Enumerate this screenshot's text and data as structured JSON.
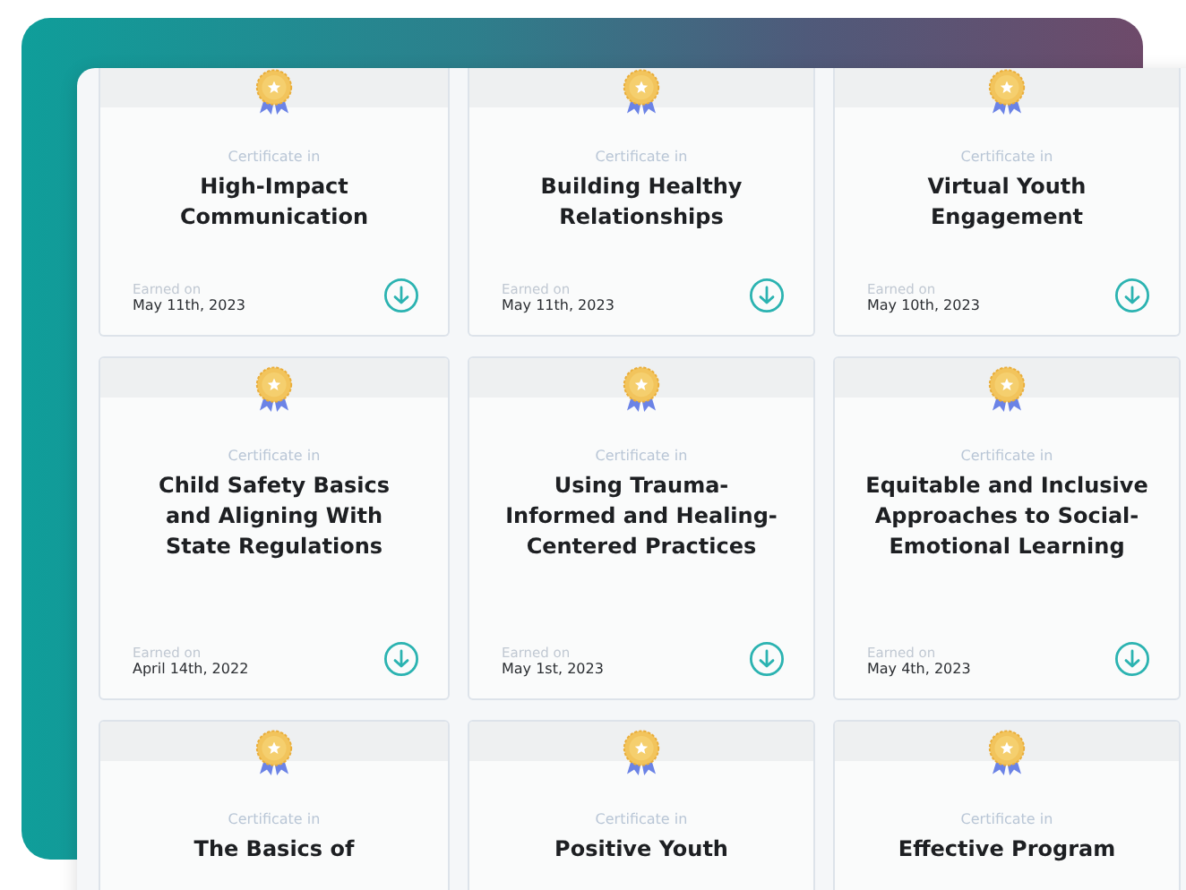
{
  "cards": [
    {
      "label": "Certificate in",
      "title": "High-Impact Communication",
      "earned_label": "Earned on",
      "date": "May 11th, 2023"
    },
    {
      "label": "Certificate in",
      "title": "Building Healthy Relationships",
      "earned_label": "Earned on",
      "date": "May 11th, 2023"
    },
    {
      "label": "Certificate in",
      "title": "Virtual Youth Engagement",
      "earned_label": "Earned on",
      "date": "May 10th, 2023"
    },
    {
      "label": "Certificate in",
      "title": "Child Safety Basics and Aligning With State Regulations",
      "earned_label": "Earned on",
      "date": "April 14th, 2022"
    },
    {
      "label": "Certificate in",
      "title": "Using Trauma-Informed and Healing-Centered Practices",
      "earned_label": "Earned on",
      "date": "May 1st, 2023"
    },
    {
      "label": "Certificate in",
      "title": "Equitable and Inclusive Approaches to Social-Emotional Learning",
      "earned_label": "Earned on",
      "date": "May 4th, 2023"
    },
    {
      "label": "Certificate in",
      "title": "The Basics of"
    },
    {
      "label": "Certificate in",
      "title": "Positive Youth"
    },
    {
      "label": "Certificate in",
      "title": "Effective Program"
    }
  ]
}
